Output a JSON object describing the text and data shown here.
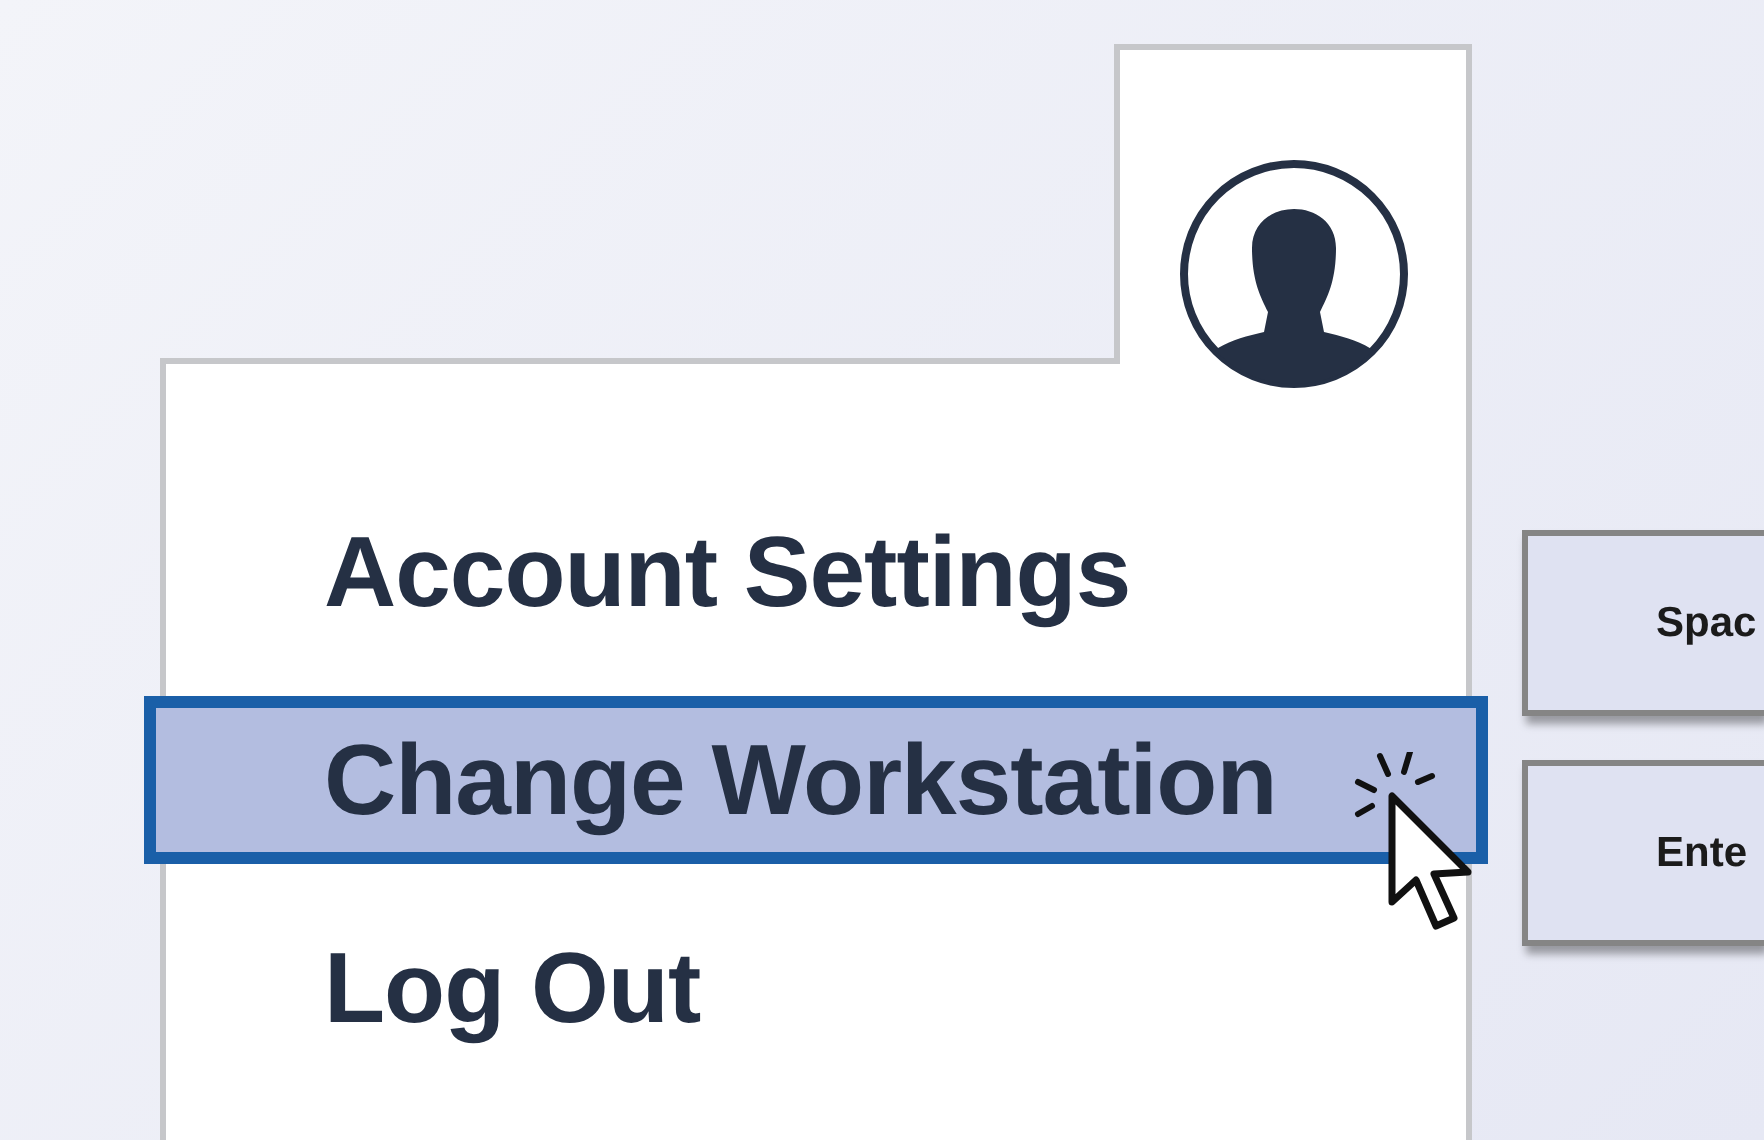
{
  "profile": {
    "kind": "avatar"
  },
  "menu": [
    {
      "label": "Account Settings",
      "selected": false
    },
    {
      "label": "Change Workstation",
      "selected": true
    },
    {
      "label": "Log Out",
      "selected": false
    }
  ],
  "keys": [
    {
      "label": "Spac"
    },
    {
      "label": "Ente"
    }
  ]
}
